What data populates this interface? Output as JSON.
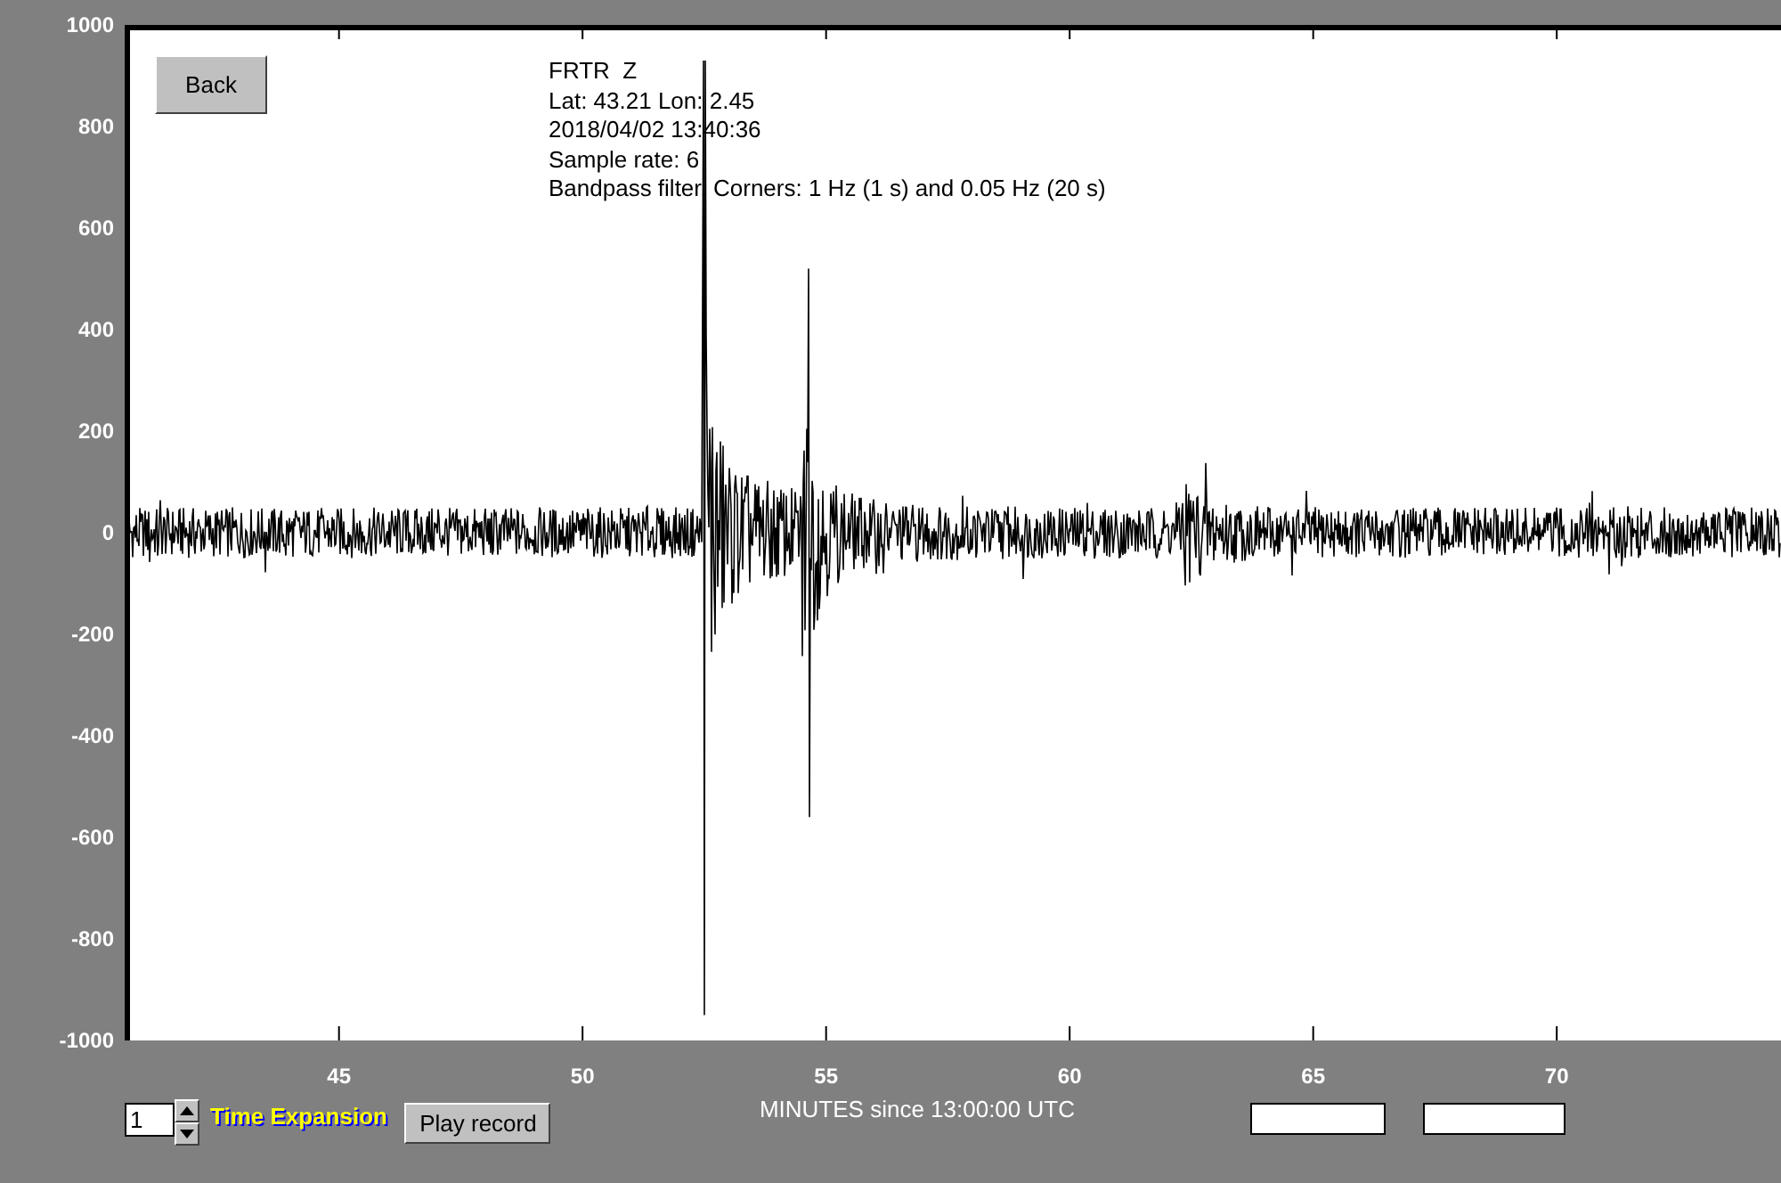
{
  "back_button": "Back",
  "station_info": [
    "FRTR  Z",
    "Lat: 43.21 Lon: 2.45",
    "2018/04/02 13:40:36",
    "Sample rate: 6",
    "Bandpass filter. Corners: 1 Hz (1 s) and 0.05 Hz (20 s)"
  ],
  "y_axis": {
    "ticks": [
      "1000",
      "800",
      "600",
      "400",
      "200",
      "0",
      "-200",
      "-400",
      "-600",
      "-800",
      "-1000"
    ]
  },
  "x_axis": {
    "ticks": [
      "45",
      "50",
      "55",
      "60",
      "65",
      "70"
    ],
    "label": "MINUTES since 13:00:00 UTC"
  },
  "time_expansion": {
    "value": "1",
    "label": "Time Expansion"
  },
  "play_button": "Play record"
}
